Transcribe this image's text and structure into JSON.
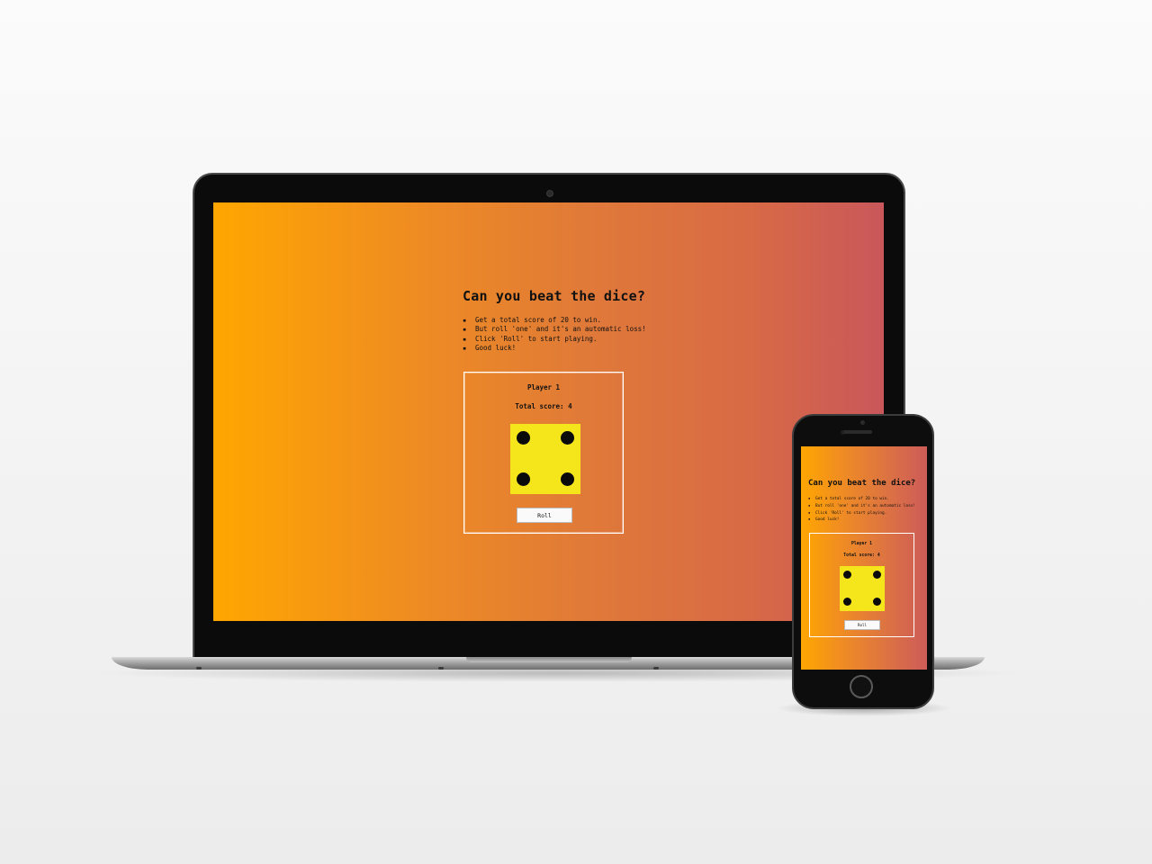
{
  "game": {
    "title": "Can you beat the dice?",
    "rules": [
      "Get a total score of 20 to win.",
      "But roll 'one' and it's an automatic loss!",
      "Click 'Roll' to start playing.",
      "Good luck!"
    ],
    "player_label": "Player 1",
    "total_score_text": "Total score: 4",
    "die_face_value": 4,
    "roll_button_label": "Roll"
  },
  "colors": {
    "gradient_start": "#ffa600",
    "gradient_end": "#c9575b",
    "die_face": "#f5e51b",
    "pip": "#0a0a0a",
    "device_frame": "#0b0b0b"
  }
}
